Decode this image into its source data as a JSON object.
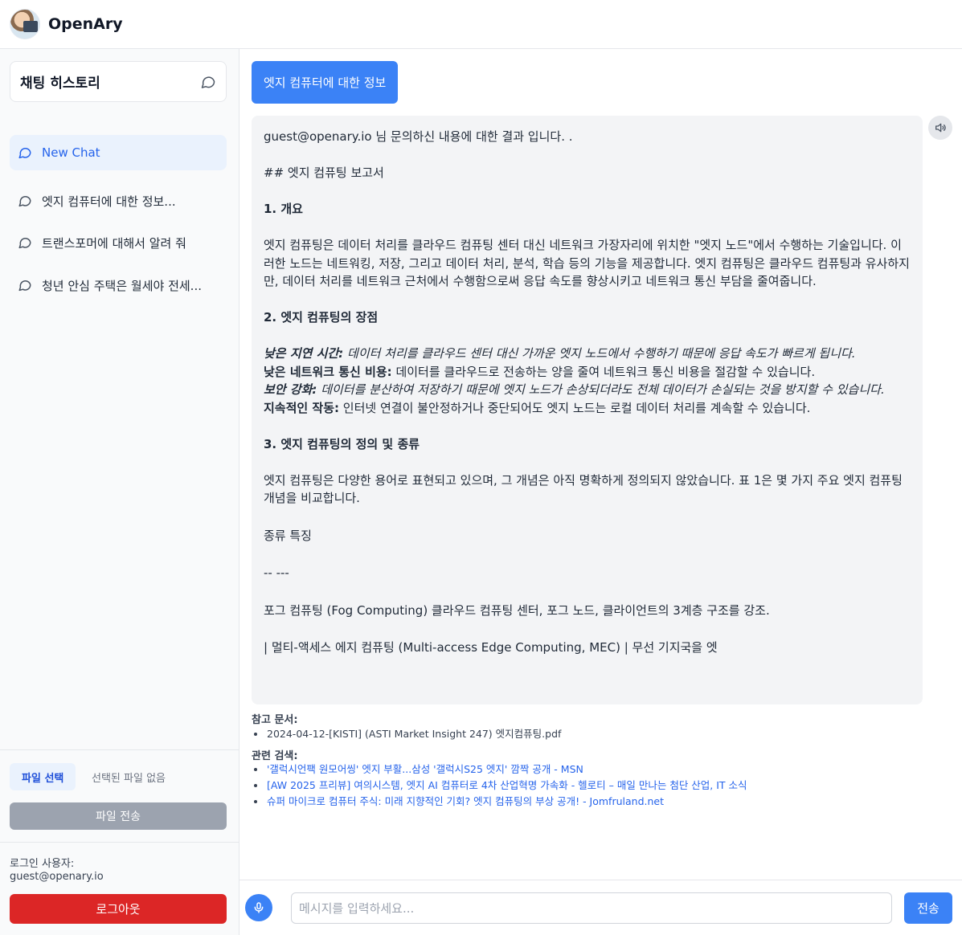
{
  "header": {
    "app_title": "OpenAry",
    "avatar_icon": "user-avatar"
  },
  "sidebar": {
    "history_title": "채팅 히스토리",
    "items": [
      {
        "label": "New Chat",
        "icon": "chat-bubble-icon",
        "active": true
      },
      {
        "label": "엣지 컴퓨터에 대한 정보...",
        "icon": "chat-bubble-icon"
      },
      {
        "label": "트랜스포머에 대해서 알려 줘",
        "icon": "chat-bubble-icon"
      },
      {
        "label": "청년 안심 주택은 월세야 전세...",
        "icon": "chat-bubble-icon"
      }
    ],
    "file_select_label": "파일 선택",
    "file_none_label": "선택된 파일 없음",
    "file_send_label": "파일 전송",
    "login_label": "로그인 사용자:",
    "login_user": "guest@openary.io",
    "logout_label": "로그아웃"
  },
  "conversation": {
    "user_message": "엣지 컴퓨터에 대한 정보",
    "answer": {
      "intro": "guest@openary.io 님 문의하신 내용에 대한 결과 입니다. .",
      "report_title": "## 엣지 컴퓨팅 보고서",
      "s1_title": "1. 개요",
      "s1_body": "엣지 컴퓨팅은 데이터 처리를 클라우드 컴퓨팅 센터 대신 네트워크 가장자리에 위치한 \"엣지 노드\"에서 수행하는 기술입니다. 이러한 노드는 네트워킹, 저장, 그리고 데이터 처리, 분석, 학습 등의 기능을 제공합니다. 엣지 컴퓨팅은 클라우드 컴퓨팅과 유사하지만, 데이터 처리를 네트워크 근처에서 수행함으로써 응답 속도를 향상시키고 네트워크 통신 부담을 줄여줍니다.",
      "s2_title": "2. 엣지 컴퓨팅의 장점",
      "adv1_label": "낮은 지연 시간:",
      "adv1_text": " 데이터 처리를 클라우드 센터 대신 가까운 엣지 노드에서 수행하기 때문에 응답 속도가 빠르게 됩니다.",
      "adv2_label": "낮은 네트워크 통신 비용:",
      "adv2_text": " 데이터를 클라우드로 전송하는 양을 줄여 네트워크 통신 비용을 절감할 수 있습니다.",
      "adv3_label": "보안 강화:",
      "adv3_text": " 데이터를 분산하여 저장하기 때문에 엣지 노드가 손상되더라도 전체 데이터가 손실되는 것을 방지할 수 있습니다.",
      "adv4_label": "지속적인 작동:",
      "adv4_text": " 인터넷 연결이 불안정하거나 중단되어도 엣지 노드는 로컬 데이터 처리를 계속할 수 있습니다.",
      "s3_title": "3. 엣지 컴퓨팅의 정의 및 종류",
      "s3_body": "엣지 컴퓨팅은 다양한 용어로 표현되고 있으며, 그 개념은 아직 명확하게 정의되지 않았습니다. 표 1은 몇 가지 주요 엣지 컴퓨팅 개념을 비교합니다.",
      "table_header": "종류 특징",
      "table_sep": "-- ---",
      "row1": "포그 컴퓨팅 (Fog Computing) 클라우드 컴퓨팅 센터, 포그 노드, 클라이언트의 3계층 구조를 강조.",
      "row2": "| 멀티-액세스 에지 컴퓨팅 (Multi-access Edge Computing, MEC) | 무선 기지국을 엣"
    },
    "references_title": "참고 문서:",
    "references": [
      "2024-04-12-[KISTI] (ASTI Market Insight 247) 엣지컴퓨팅.pdf"
    ],
    "related_title": "관련 검색:",
    "related": [
      "'갤럭시언팩 원모어씽' 엣지 부활...삼성 '갤럭시S25 엣지' 깜짝 공개 - MSN",
      "[AW 2025 프리뷰] 여의시스템, 엣지 AI 컴퓨터로 4차 산업혁명 가속화 - 헬로티 – 매일 만나는 첨단 산업, IT 소식",
      "슈퍼 마이크로 컴퓨터 주식: 미래 지향적인 기회? 엣지 컴퓨팅의 부상 공개! - Jomfruland.net"
    ]
  },
  "input": {
    "placeholder": "메시지를 입력하세요...",
    "value": "",
    "send_label": "전송"
  },
  "colors": {
    "accent": "#3b82f6",
    "active_bg": "#eaf2fd",
    "danger": "#dc2626",
    "disabled": "#9ca3af"
  }
}
